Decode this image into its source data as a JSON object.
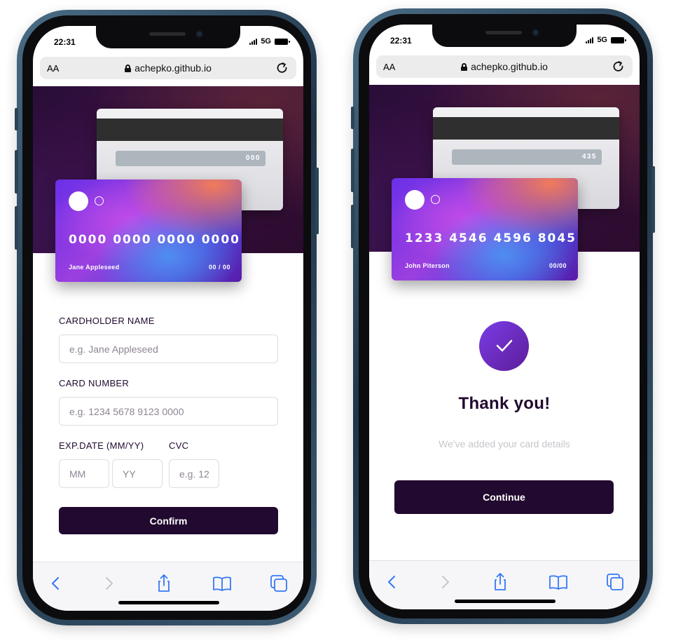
{
  "left_phone": {
    "status": {
      "time": "22:31",
      "network": "5G"
    },
    "browser": {
      "aa": "AA",
      "host": "achepko.github.io"
    },
    "card_back": {
      "cvc": "000"
    },
    "card_front": {
      "number": "0000 0000 0000 0000",
      "holder": "Jane Appleseed",
      "expiry": "00 / 00"
    },
    "form": {
      "cardholder_label": "CARDHOLDER NAME",
      "cardholder_placeholder": "e.g. Jane Appleseed",
      "number_label": "CARD NUMBER",
      "number_placeholder": "e.g. 1234 5678 9123 0000",
      "exp_label": "EXP.DATE (MM/YY)",
      "mm_placeholder": "MM",
      "yy_placeholder": "YY",
      "cvc_label": "CVC",
      "cvc_placeholder": "e.g. 12",
      "confirm_label": "Confirm"
    }
  },
  "right_phone": {
    "status": {
      "time": "22:31",
      "network": "5G"
    },
    "browser": {
      "aa": "AA",
      "host": "achepko.github.io"
    },
    "card_back": {
      "cvc": "435"
    },
    "card_front": {
      "number": "1233 4546 4596 8045",
      "holder": "John Piterson",
      "expiry": "00/00"
    },
    "complete": {
      "title": "Thank you!",
      "message": "We've added your card details",
      "continue_label": "Continue"
    }
  },
  "toolbar_icons": [
    "back-icon",
    "forward-icon",
    "share-icon",
    "bookmarks-icon",
    "tabs-icon"
  ],
  "colors": {
    "dark_violet": "#21092f",
    "placeholder": "#8e8593",
    "link_blue": "#3478f6",
    "disabled": "#c7c7cc"
  }
}
